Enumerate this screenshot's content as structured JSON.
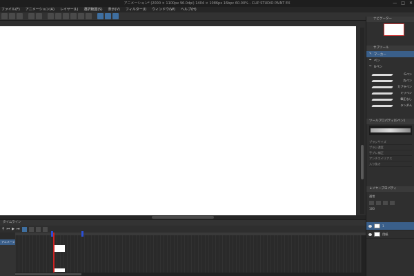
{
  "window": {
    "title": "アニメーション* (2000 × 1100px 96.0dpi) 1404 × 1086px 16bpc 60.00% - CLIP STUDIO PAINT EX",
    "controls": [
      "—",
      "□",
      "✕"
    ]
  },
  "menu": [
    "ファイル(F)",
    "アニメーション(A)",
    "レイヤー(L)",
    "選択範囲(S)",
    "表示(V)",
    "フィルター(I)",
    "ウィンドウ(W)",
    "ヘルプ(H)"
  ],
  "panels": {
    "navigator": "ナビゲーター",
    "tools": {
      "header": "サブツール",
      "items": [
        "マーカー",
        "ペン",
        "Gペン",
        "リアル鉛筆"
      ]
    },
    "brushes": [
      "Gペン",
      "丸ペン",
      "カブラペン",
      "ミリペン",
      "筆圧なし",
      "ランダム"
    ],
    "tool_property": {
      "header": "ツールプロパティ[Gペン]",
      "rows": [
        "ブラシサイズ",
        "ブラシ濃度",
        "手ブレ補正",
        "アンチエイリアス",
        "入り抜き"
      ]
    },
    "layer_property": {
      "header": "レイヤープロパティ",
      "blend": "通常",
      "opacity": "100",
      "layers": [
        {
          "name": "1",
          "selected": true
        },
        {
          "name": "用紙",
          "selected": false
        }
      ]
    }
  },
  "timeline": {
    "header": "タイムライン",
    "track_name": "アニメーション",
    "frame_label": "1"
  },
  "colors": {
    "accent": "#3a5f8a",
    "playhead": "#cc2222",
    "marker": "#2b4fd6"
  }
}
